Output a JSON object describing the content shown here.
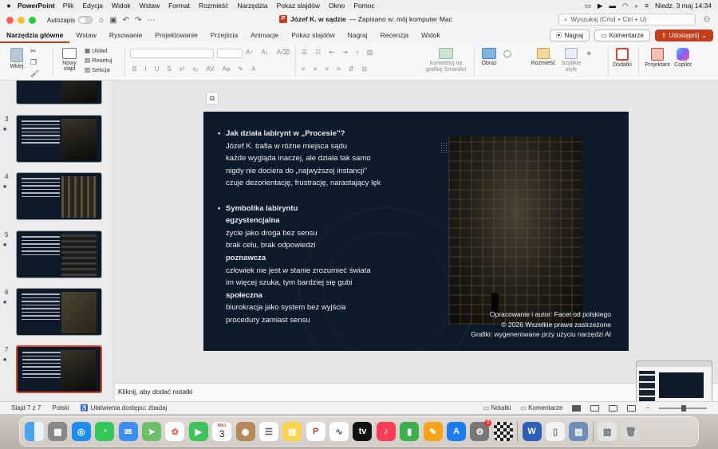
{
  "menubar": {
    "app": "PowerPoint",
    "items": [
      "Plik",
      "Edycja",
      "Widok",
      "Wstaw",
      "Format",
      "Rozmieść",
      "Narzędzia",
      "Pokaz slajdów",
      "Okno",
      "Pomoc"
    ],
    "clock": "Niedz. 3 maj  14:34"
  },
  "titlebar": {
    "autosave_label": "Autozapis",
    "doc_title": "Józef K. w sądzie",
    "doc_status": "— Zapisano w: mój komputer Mac",
    "search_placeholder": "Wyszukaj (Cmd + Ctrl + U)"
  },
  "ribbon_tabs": [
    "Narzędzia główne",
    "Wstaw",
    "Rysowanie",
    "Projektowanie",
    "Przejścia",
    "Animacje",
    "Pokaz slajdów",
    "Nagraj",
    "Recenzja",
    "Widok"
  ],
  "tab_actions": {
    "record": "Nagraj",
    "comments": "Komentarze",
    "share": "Udostępnij"
  },
  "ribbon": {
    "paste": "Wklej",
    "new_slide": "Nowy slajd",
    "layout": "Układ",
    "reset": "Resetuj",
    "section": "Sekcja",
    "smartart": "Konwertuj na grafikę SmartArt",
    "picture": "Obraz",
    "arrange": "Rozmieść",
    "quick_styles": "Szybkie style",
    "addins": "Dodatki",
    "designer": "Projektant",
    "copilot": "Copilot"
  },
  "thumbnails": [
    {
      "num": "",
      "star": false
    },
    {
      "num": "3",
      "star": true
    },
    {
      "num": "4",
      "star": true
    },
    {
      "num": "5",
      "star": true
    },
    {
      "num": "6",
      "star": true
    },
    {
      "num": "7",
      "star": true,
      "selected": true
    }
  ],
  "slide": {
    "lines": [
      {
        "text": "Jak działa labirynt w „Procesie”?",
        "bold": true,
        "dot": true
      },
      {
        "text": "Józef K. trafia w różne miejsca sądu",
        "bold": false
      },
      {
        "text": "każde wygląda inaczej, ale działa tak samo",
        "bold": false
      },
      {
        "text": "nigdy nie dociera do „najwyższej instancji”",
        "bold": false
      },
      {
        "text": "czuje dezorientację, frustrację, narastający lęk",
        "bold": false
      },
      {
        "text": "",
        "gap": true
      },
      {
        "text": "Symbolika labiryntu",
        "bold": true,
        "dot": true
      },
      {
        "text": "egzystencjalna",
        "bold": true
      },
      {
        "text": "życie jako droga bez sensu",
        "bold": false
      },
      {
        "text": "brak celu, brak odpowiedzi",
        "bold": false
      },
      {
        "text": "poznawcza",
        "bold": true
      },
      {
        "text": "człowiek nie jest w stanie zrozumieć świata",
        "bold": false
      },
      {
        "text": "im więcej szuka, tym bardziej się gubi",
        "bold": false
      },
      {
        "text": "społeczna",
        "bold": true
      },
      {
        "text": "biurokracja jako system bez wyjścia",
        "bold": false
      },
      {
        "text": "procedury zamiast sensu",
        "bold": false
      }
    ],
    "credit1": "Opracowanie i autor: Facet od polskiego",
    "credit2": "© 2026 Wszelkie prawa zastrzeżone",
    "credit3": "Grafiki: wygenerowane przy użyciu narzędzi AI"
  },
  "notes_placeholder": "Kliknij, aby dodać notatki",
  "status": {
    "slide_counter": "Slajd 7 z 7",
    "language": "Polski",
    "accessibility": "Ułatwienia dostępu: zbadaj",
    "notes": "Notatki",
    "comments": "Komentarze"
  },
  "dock": {
    "calendar_month": "MAJ",
    "calendar_day": "3",
    "badge": "1"
  }
}
